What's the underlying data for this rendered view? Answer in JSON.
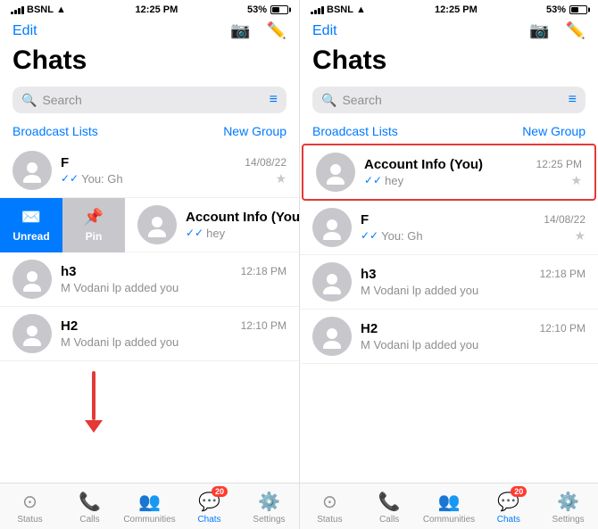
{
  "panels": [
    {
      "id": "left",
      "statusBar": {
        "carrier": "BSNL",
        "time": "12:25 PM",
        "battery": "53%"
      },
      "header": {
        "edit": "Edit",
        "cameraIcon": "📷",
        "composeIcon": "✏️"
      },
      "title": "Chats",
      "search": {
        "placeholder": "Search"
      },
      "broadcastLabel": "Broadcast Lists",
      "newGroupLabel": "New Group",
      "chats": [
        {
          "name": "F",
          "preview": "You: Gh",
          "time": "14/08/22",
          "starred": true,
          "hasCheck": true,
          "highlighted": false
        },
        {
          "name": "Account Info (You",
          "preview": "hey",
          "time": "",
          "starred": true,
          "hasCheck": true,
          "highlighted": false,
          "swipe": true
        },
        {
          "name": "h3",
          "preview": "M Vodani lp added you",
          "time": "12:18 PM",
          "starred": false,
          "hasCheck": false,
          "highlighted": false
        },
        {
          "name": "H2",
          "preview": "M Vodani lp added you",
          "time": "12:10 PM",
          "starred": false,
          "hasCheck": false,
          "highlighted": false
        }
      ],
      "swipeActions": [
        {
          "label": "Unread",
          "type": "unread"
        },
        {
          "label": "Pin",
          "type": "pin"
        }
      ],
      "tabs": [
        {
          "icon": "⊙",
          "label": "Status",
          "active": false
        },
        {
          "icon": "📞",
          "label": "Calls",
          "active": false
        },
        {
          "icon": "👥",
          "label": "Communities",
          "active": false
        },
        {
          "icon": "💬",
          "label": "Chats",
          "active": true,
          "badge": "20"
        },
        {
          "icon": "⚙️",
          "label": "Settings",
          "active": false
        }
      ]
    },
    {
      "id": "right",
      "statusBar": {
        "carrier": "BSNL",
        "time": "12:25 PM",
        "battery": "53%"
      },
      "header": {
        "edit": "Edit",
        "cameraIcon": "📷",
        "composeIcon": "✏️"
      },
      "title": "Chats",
      "search": {
        "placeholder": "Search"
      },
      "broadcastLabel": "Broadcast Lists",
      "newGroupLabel": "New Group",
      "chats": [
        {
          "name": "Account Info (You)",
          "preview": "hey",
          "time": "12:25 PM",
          "starred": true,
          "hasCheck": true,
          "highlighted": true,
          "bold": true
        },
        {
          "name": "F",
          "preview": "You: Gh",
          "time": "14/08/22",
          "starred": true,
          "hasCheck": true,
          "highlighted": false
        },
        {
          "name": "h3",
          "preview": "M Vodani lp added you",
          "time": "12:18 PM",
          "starred": false,
          "hasCheck": false,
          "highlighted": false
        },
        {
          "name": "H2",
          "preview": "M Vodani lp added you",
          "time": "12:10 PM",
          "starred": false,
          "hasCheck": false,
          "highlighted": false
        }
      ],
      "tabs": [
        {
          "icon": "⊙",
          "label": "Status",
          "active": false
        },
        {
          "icon": "📞",
          "label": "Calls",
          "active": false
        },
        {
          "icon": "👥",
          "label": "Communities",
          "active": false
        },
        {
          "icon": "💬",
          "label": "Chats",
          "active": true,
          "badge": "20"
        },
        {
          "icon": "⚙️",
          "label": "Settings",
          "active": false
        }
      ]
    }
  ]
}
